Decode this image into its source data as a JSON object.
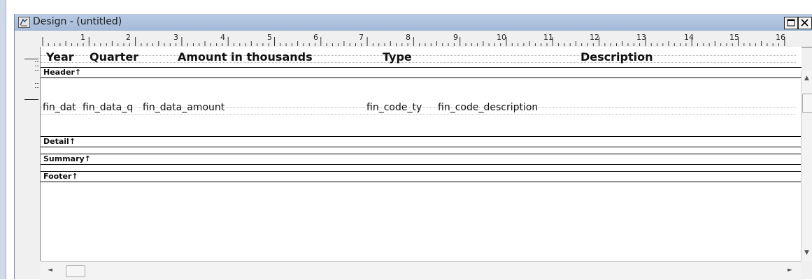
{
  "window": {
    "title": "Design - (untitled)",
    "icon": "design-window-icon",
    "maximize_icon": "maximize-icon",
    "close_icon": "close-icon"
  },
  "ruler": {
    "numbers": [
      "1",
      "2",
      "3",
      "4",
      "5",
      "6",
      "7",
      "8",
      "9",
      "10",
      "11",
      "12",
      "13",
      "14",
      "15",
      "16"
    ]
  },
  "header_columns": {
    "year": "Year",
    "quarter": "Quarter",
    "amount": "Amount in thousands",
    "type": "Type",
    "description": "Description"
  },
  "bands": {
    "header": "Header↑",
    "detail": "Detail↑",
    "summary": "Summary↑",
    "footer": "Footer↑"
  },
  "detail_fields": {
    "year": "fin_dat",
    "quarter": "fin_data_q",
    "amount": "fin_data_amount",
    "type": "fin_code_ty",
    "description": "fin_code_description"
  },
  "scrollbars": {
    "up_arrow": "▲",
    "down_arrow": "▼",
    "left_arrow": "◄",
    "right_arrow": "►"
  },
  "colors": {
    "titlebar": "#a4bad8",
    "canvas": "#ffffff",
    "chrome": "#f0f0f0"
  }
}
